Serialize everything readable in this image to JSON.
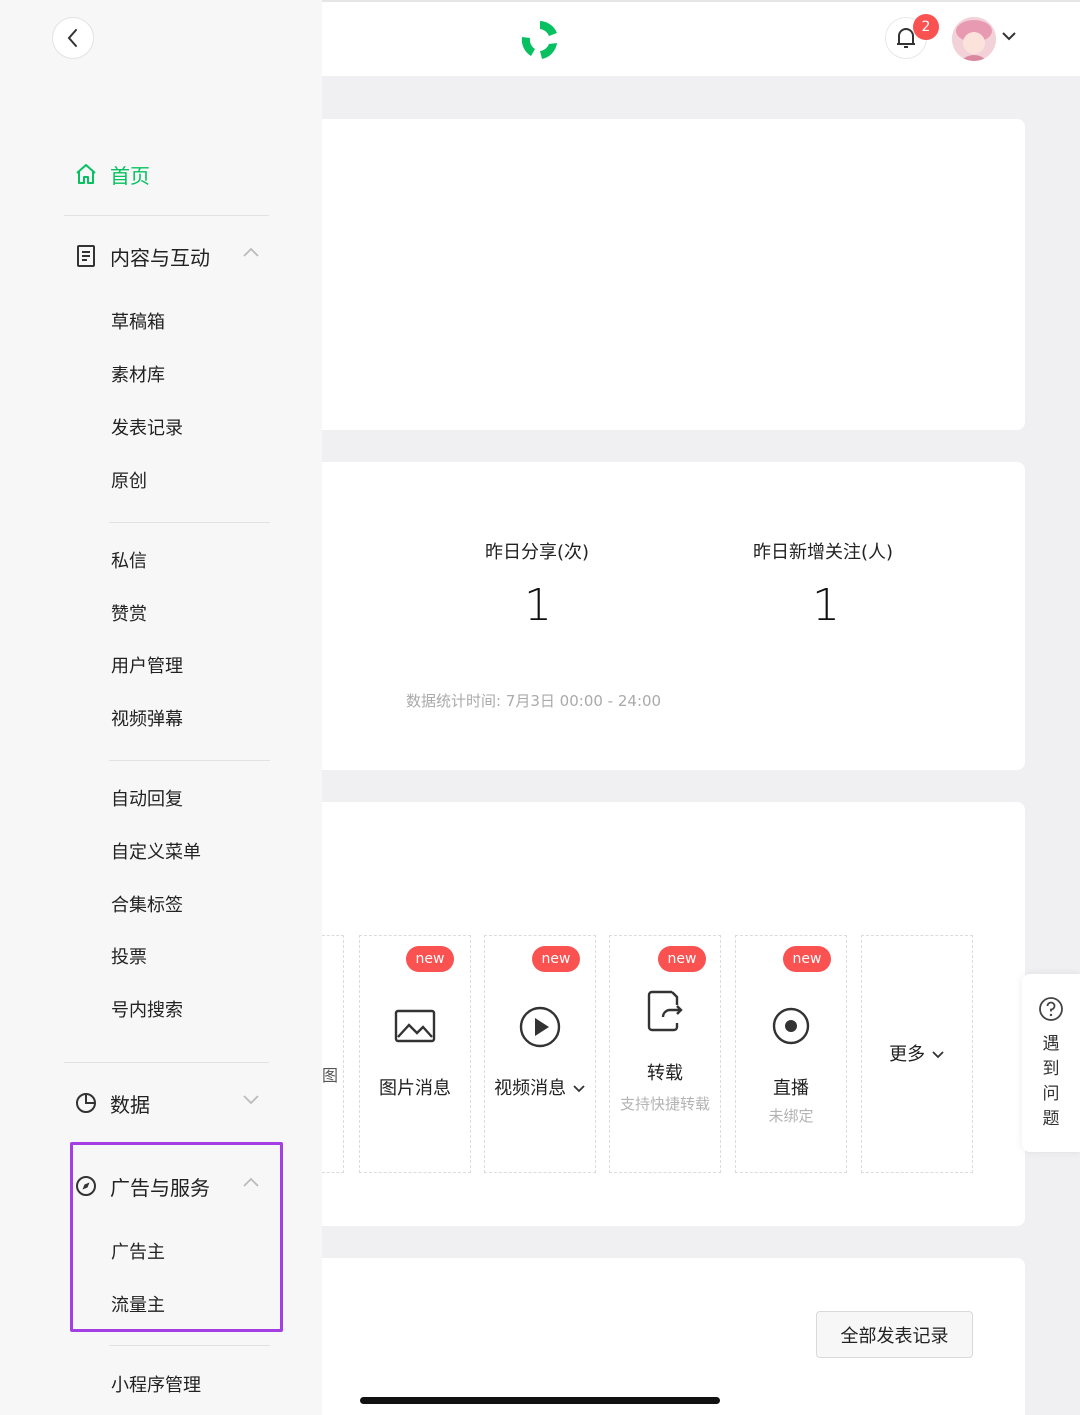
{
  "sidebar": {
    "home_label": "首页",
    "content_group": {
      "label": "内容与互动",
      "items": [
        "草稿箱",
        "素材库",
        "发表记录",
        "原创",
        "私信",
        "赞赏",
        "用户管理",
        "视频弹幕",
        "自动回复",
        "自定义菜单",
        "合集标签",
        "投票",
        "号内搜索"
      ]
    },
    "data_group": {
      "label": "数据"
    },
    "ads_group": {
      "label": "广告与服务",
      "items": [
        "广告主",
        "流量主"
      ]
    },
    "mini_program_label": "小程序管理"
  },
  "header": {
    "notification_count": "2"
  },
  "stats": {
    "shares_label": "昨日分享(次)",
    "shares_value": "1",
    "followers_label": "昨日新增关注(人)",
    "followers_value": "1",
    "time_note": "数据统计时间: 7月3日 00:00 - 24:00"
  },
  "create": {
    "partial_label": "图",
    "new_badge": "new",
    "tiles": {
      "image": "图片消息",
      "video": "视频消息",
      "repost": "转载",
      "repost_sub": "支持快捷转载",
      "live": "直播",
      "live_sub": "未绑定",
      "more": "更多"
    }
  },
  "publish": {
    "all_records_label": "全部发表记录"
  },
  "help": {
    "label": "遇到问题"
  },
  "colors": {
    "accent": "#07c160",
    "badge": "#fa5151",
    "highlight": "#a43fe3"
  }
}
